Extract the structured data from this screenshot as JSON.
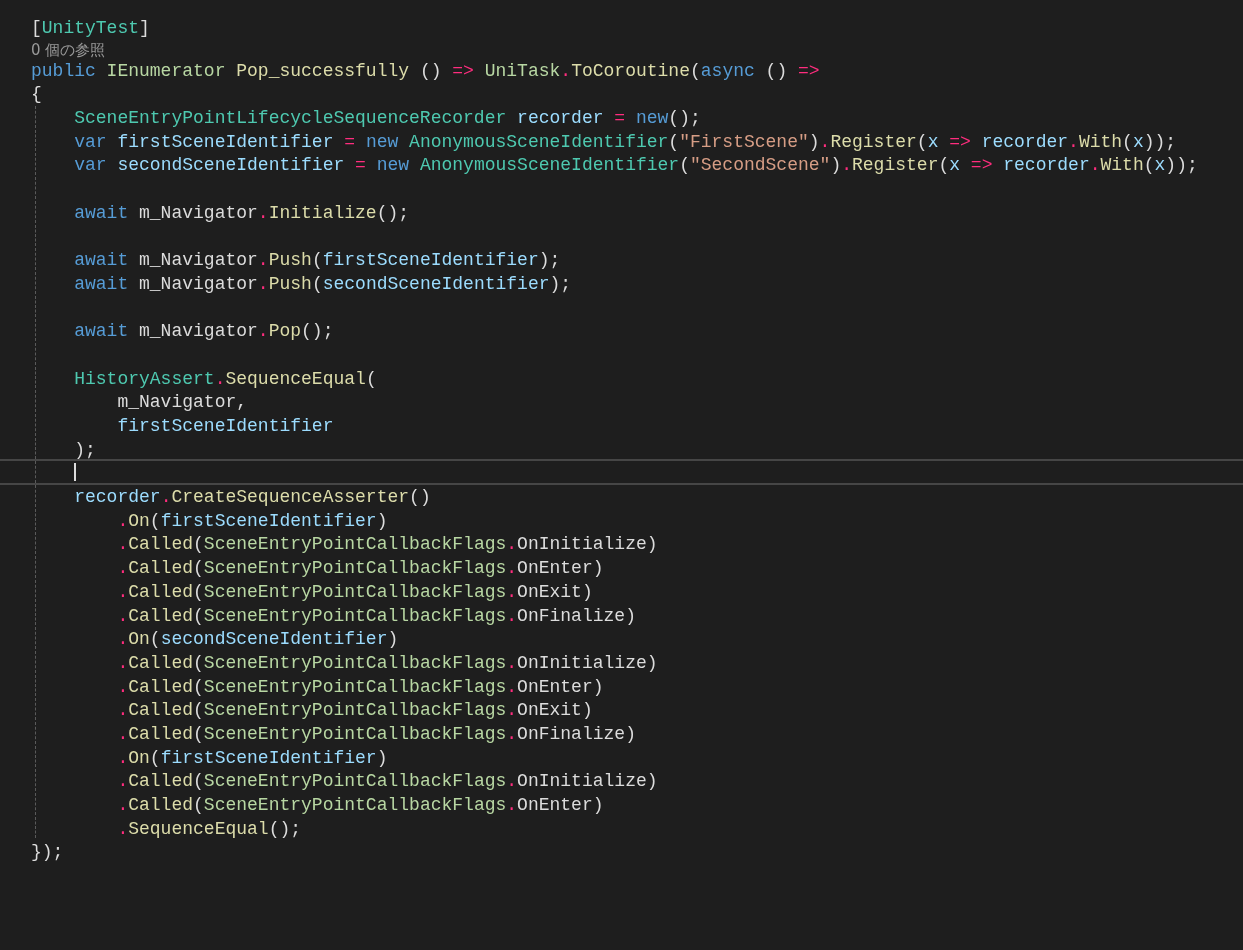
{
  "editor": {
    "lines": [
      {
        "kind": "code",
        "current": false,
        "tokens": [
          {
            "kind": "punct",
            "text": "["
          },
          {
            "kind": "type",
            "text": "UnityTest"
          },
          {
            "kind": "punct",
            "text": "]"
          }
        ]
      },
      {
        "kind": "codelens",
        "current": false,
        "text": "0 個の参照"
      },
      {
        "kind": "code",
        "current": false,
        "tokens": [
          {
            "kind": "keyword",
            "text": "public"
          },
          {
            "kind": "interface",
            "text": " IEnumerator"
          },
          {
            "kind": "method",
            "text": " Pop_successfully"
          },
          {
            "kind": "punct",
            "text": " () "
          },
          {
            "kind": "operator",
            "text": "=>"
          },
          {
            "kind": "interface",
            "text": " UniTask"
          },
          {
            "kind": "operator",
            "text": "."
          },
          {
            "kind": "method",
            "text": "ToCoroutine"
          },
          {
            "kind": "punct",
            "text": "("
          },
          {
            "kind": "keyword",
            "text": "async"
          },
          {
            "kind": "punct",
            "text": " () "
          },
          {
            "kind": "operator",
            "text": "=>"
          }
        ]
      },
      {
        "kind": "code",
        "current": false,
        "tokens": [
          {
            "kind": "punct",
            "text": "{"
          }
        ]
      },
      {
        "kind": "code",
        "current": false,
        "tokens": [
          {
            "kind": "type",
            "text": "    SceneEntryPointLifecycleSequenceRecorder"
          },
          {
            "kind": "local",
            "text": " recorder"
          },
          {
            "kind": "operator",
            "text": " ="
          },
          {
            "kind": "keyword",
            "text": " new"
          },
          {
            "kind": "punct",
            "text": "();"
          }
        ]
      },
      {
        "kind": "code",
        "current": false,
        "tokens": [
          {
            "kind": "keyword",
            "text": "    var"
          },
          {
            "kind": "local",
            "text": " firstSceneIdentifier"
          },
          {
            "kind": "operator",
            "text": " ="
          },
          {
            "kind": "keyword",
            "text": " new"
          },
          {
            "kind": "type",
            "text": " AnonymousSceneIdentifier"
          },
          {
            "kind": "punct",
            "text": "("
          },
          {
            "kind": "string",
            "text": "\"FirstScene\""
          },
          {
            "kind": "punct",
            "text": ")"
          },
          {
            "kind": "operator",
            "text": "."
          },
          {
            "kind": "method",
            "text": "Register"
          },
          {
            "kind": "punct",
            "text": "("
          },
          {
            "kind": "local",
            "text": "x"
          },
          {
            "kind": "operator",
            "text": " =>"
          },
          {
            "kind": "local",
            "text": " recorder"
          },
          {
            "kind": "operator",
            "text": "."
          },
          {
            "kind": "method",
            "text": "With"
          },
          {
            "kind": "punct",
            "text": "("
          },
          {
            "kind": "local",
            "text": "x"
          },
          {
            "kind": "punct",
            "text": "));"
          }
        ]
      },
      {
        "kind": "code",
        "current": false,
        "tokens": [
          {
            "kind": "keyword",
            "text": "    var"
          },
          {
            "kind": "local",
            "text": " secondSceneIdentifier"
          },
          {
            "kind": "operator",
            "text": " ="
          },
          {
            "kind": "keyword",
            "text": " new"
          },
          {
            "kind": "type",
            "text": " AnonymousSceneIdentifier"
          },
          {
            "kind": "punct",
            "text": "("
          },
          {
            "kind": "string",
            "text": "\"SecondScene\""
          },
          {
            "kind": "punct",
            "text": ")"
          },
          {
            "kind": "operator",
            "text": "."
          },
          {
            "kind": "method",
            "text": "Register"
          },
          {
            "kind": "punct",
            "text": "("
          },
          {
            "kind": "local",
            "text": "x"
          },
          {
            "kind": "operator",
            "text": " =>"
          },
          {
            "kind": "local",
            "text": " recorder"
          },
          {
            "kind": "operator",
            "text": "."
          },
          {
            "kind": "method",
            "text": "With"
          },
          {
            "kind": "punct",
            "text": "("
          },
          {
            "kind": "local",
            "text": "x"
          },
          {
            "kind": "punct",
            "text": "));"
          }
        ]
      },
      {
        "kind": "code",
        "current": false
      },
      {
        "kind": "code",
        "current": false,
        "tokens": [
          {
            "kind": "keyword",
            "text": "    await"
          },
          {
            "kind": "field",
            "text": " m_Navigator"
          },
          {
            "kind": "operator",
            "text": "."
          },
          {
            "kind": "method",
            "text": "Initialize"
          },
          {
            "kind": "punct",
            "text": "();"
          }
        ]
      },
      {
        "kind": "code",
        "current": false
      },
      {
        "kind": "code",
        "current": false,
        "tokens": [
          {
            "kind": "keyword",
            "text": "    await"
          },
          {
            "kind": "field",
            "text": " m_Navigator"
          },
          {
            "kind": "operator",
            "text": "."
          },
          {
            "kind": "method",
            "text": "Push"
          },
          {
            "kind": "punct",
            "text": "("
          },
          {
            "kind": "local",
            "text": "firstSceneIdentifier"
          },
          {
            "kind": "punct",
            "text": ");"
          }
        ]
      },
      {
        "kind": "code",
        "current": false,
        "tokens": [
          {
            "kind": "keyword",
            "text": "    await"
          },
          {
            "kind": "field",
            "text": " m_Navigator"
          },
          {
            "kind": "operator",
            "text": "."
          },
          {
            "kind": "method",
            "text": "Push"
          },
          {
            "kind": "punct",
            "text": "("
          },
          {
            "kind": "local",
            "text": "secondSceneIdentifier"
          },
          {
            "kind": "punct",
            "text": ");"
          }
        ]
      },
      {
        "kind": "code",
        "current": false
      },
      {
        "kind": "code",
        "current": false,
        "tokens": [
          {
            "kind": "keyword",
            "text": "    await"
          },
          {
            "kind": "field",
            "text": " m_Navigator"
          },
          {
            "kind": "operator",
            "text": "."
          },
          {
            "kind": "method",
            "text": "Pop"
          },
          {
            "kind": "punct",
            "text": "();"
          }
        ]
      },
      {
        "kind": "code",
        "current": false
      },
      {
        "kind": "code",
        "current": false,
        "tokens": [
          {
            "kind": "type",
            "text": "    HistoryAssert"
          },
          {
            "kind": "operator",
            "text": "."
          },
          {
            "kind": "method",
            "text": "SequenceEqual"
          },
          {
            "kind": "punct",
            "text": "("
          }
        ]
      },
      {
        "kind": "code",
        "current": false,
        "tokens": [
          {
            "kind": "field",
            "text": "        m_Navigator"
          },
          {
            "kind": "punct",
            "text": ","
          }
        ]
      },
      {
        "kind": "code",
        "current": false,
        "tokens": [
          {
            "kind": "local",
            "text": "        firstSceneIdentifier"
          }
        ]
      },
      {
        "kind": "code",
        "current": false,
        "tokens": [
          {
            "kind": "punct",
            "text": "    );"
          }
        ]
      },
      {
        "kind": "code",
        "current": true
      },
      {
        "kind": "code",
        "current": false,
        "tokens": [
          {
            "kind": "local",
            "text": "    recorder"
          },
          {
            "kind": "operator",
            "text": "."
          },
          {
            "kind": "method",
            "text": "CreateSequenceAsserter"
          },
          {
            "kind": "punct",
            "text": "()"
          }
        ]
      },
      {
        "kind": "code",
        "current": false,
        "tokens": [
          {
            "kind": "operator",
            "text": "        ."
          },
          {
            "kind": "method",
            "text": "On"
          },
          {
            "kind": "punct",
            "text": "("
          },
          {
            "kind": "local",
            "text": "firstSceneIdentifier"
          },
          {
            "kind": "punct",
            "text": ")"
          }
        ]
      },
      {
        "kind": "code",
        "current": false,
        "tokens": [
          {
            "kind": "operator",
            "text": "        ."
          },
          {
            "kind": "method",
            "text": "Called"
          },
          {
            "kind": "punct",
            "text": "("
          },
          {
            "kind": "interface",
            "text": "SceneEntryPointCallbackFlags"
          },
          {
            "kind": "operator",
            "text": "."
          },
          {
            "kind": "field",
            "text": "OnInitialize"
          },
          {
            "kind": "punct",
            "text": ")"
          }
        ]
      },
      {
        "kind": "code",
        "current": false,
        "tokens": [
          {
            "kind": "operator",
            "text": "        ."
          },
          {
            "kind": "method",
            "text": "Called"
          },
          {
            "kind": "punct",
            "text": "("
          },
          {
            "kind": "interface",
            "text": "SceneEntryPointCallbackFlags"
          },
          {
            "kind": "operator",
            "text": "."
          },
          {
            "kind": "field",
            "text": "OnEnter"
          },
          {
            "kind": "punct",
            "text": ")"
          }
        ]
      },
      {
        "kind": "code",
        "current": false,
        "tokens": [
          {
            "kind": "operator",
            "text": "        ."
          },
          {
            "kind": "method",
            "text": "Called"
          },
          {
            "kind": "punct",
            "text": "("
          },
          {
            "kind": "interface",
            "text": "SceneEntryPointCallbackFlags"
          },
          {
            "kind": "operator",
            "text": "."
          },
          {
            "kind": "field",
            "text": "OnExit"
          },
          {
            "kind": "punct",
            "text": ")"
          }
        ]
      },
      {
        "kind": "code",
        "current": false,
        "tokens": [
          {
            "kind": "operator",
            "text": "        ."
          },
          {
            "kind": "method",
            "text": "Called"
          },
          {
            "kind": "punct",
            "text": "("
          },
          {
            "kind": "interface",
            "text": "SceneEntryPointCallbackFlags"
          },
          {
            "kind": "operator",
            "text": "."
          },
          {
            "kind": "field",
            "text": "OnFinalize"
          },
          {
            "kind": "punct",
            "text": ")"
          }
        ]
      },
      {
        "kind": "code",
        "current": false,
        "tokens": [
          {
            "kind": "operator",
            "text": "        ."
          },
          {
            "kind": "method",
            "text": "On"
          },
          {
            "kind": "punct",
            "text": "("
          },
          {
            "kind": "local",
            "text": "secondSceneIdentifier"
          },
          {
            "kind": "punct",
            "text": ")"
          }
        ]
      },
      {
        "kind": "code",
        "current": false,
        "tokens": [
          {
            "kind": "operator",
            "text": "        ."
          },
          {
            "kind": "method",
            "text": "Called"
          },
          {
            "kind": "punct",
            "text": "("
          },
          {
            "kind": "interface",
            "text": "SceneEntryPointCallbackFlags"
          },
          {
            "kind": "operator",
            "text": "."
          },
          {
            "kind": "field",
            "text": "OnInitialize"
          },
          {
            "kind": "punct",
            "text": ")"
          }
        ]
      },
      {
        "kind": "code",
        "current": false,
        "tokens": [
          {
            "kind": "operator",
            "text": "        ."
          },
          {
            "kind": "method",
            "text": "Called"
          },
          {
            "kind": "punct",
            "text": "("
          },
          {
            "kind": "interface",
            "text": "SceneEntryPointCallbackFlags"
          },
          {
            "kind": "operator",
            "text": "."
          },
          {
            "kind": "field",
            "text": "OnEnter"
          },
          {
            "kind": "punct",
            "text": ")"
          }
        ]
      },
      {
        "kind": "code",
        "current": false,
        "tokens": [
          {
            "kind": "operator",
            "text": "        ."
          },
          {
            "kind": "method",
            "text": "Called"
          },
          {
            "kind": "punct",
            "text": "("
          },
          {
            "kind": "interface",
            "text": "SceneEntryPointCallbackFlags"
          },
          {
            "kind": "operator",
            "text": "."
          },
          {
            "kind": "field",
            "text": "OnExit"
          },
          {
            "kind": "punct",
            "text": ")"
          }
        ]
      },
      {
        "kind": "code",
        "current": false,
        "tokens": [
          {
            "kind": "operator",
            "text": "        ."
          },
          {
            "kind": "method",
            "text": "Called"
          },
          {
            "kind": "punct",
            "text": "("
          },
          {
            "kind": "interface",
            "text": "SceneEntryPointCallbackFlags"
          },
          {
            "kind": "operator",
            "text": "."
          },
          {
            "kind": "field",
            "text": "OnFinalize"
          },
          {
            "kind": "punct",
            "text": ")"
          }
        ]
      },
      {
        "kind": "code",
        "current": false,
        "tokens": [
          {
            "kind": "operator",
            "text": "        ."
          },
          {
            "kind": "method",
            "text": "On"
          },
          {
            "kind": "punct",
            "text": "("
          },
          {
            "kind": "local",
            "text": "firstSceneIdentifier"
          },
          {
            "kind": "punct",
            "text": ")"
          }
        ]
      },
      {
        "kind": "code",
        "current": false,
        "tokens": [
          {
            "kind": "operator",
            "text": "        ."
          },
          {
            "kind": "method",
            "text": "Called"
          },
          {
            "kind": "punct",
            "text": "("
          },
          {
            "kind": "interface",
            "text": "SceneEntryPointCallbackFlags"
          },
          {
            "kind": "operator",
            "text": "."
          },
          {
            "kind": "field",
            "text": "OnInitialize"
          },
          {
            "kind": "punct",
            "text": ")"
          }
        ]
      },
      {
        "kind": "code",
        "current": false,
        "tokens": [
          {
            "kind": "operator",
            "text": "        ."
          },
          {
            "kind": "method",
            "text": "Called"
          },
          {
            "kind": "punct",
            "text": "("
          },
          {
            "kind": "interface",
            "text": "SceneEntryPointCallbackFlags"
          },
          {
            "kind": "operator",
            "text": "."
          },
          {
            "kind": "field",
            "text": "OnEnter"
          },
          {
            "kind": "punct",
            "text": ")"
          }
        ]
      },
      {
        "kind": "code",
        "current": false,
        "tokens": [
          {
            "kind": "operator",
            "text": "        ."
          },
          {
            "kind": "method",
            "text": "SequenceEqual"
          },
          {
            "kind": "punct",
            "text": "();"
          }
        ]
      },
      {
        "kind": "code",
        "current": false,
        "tokens": [
          {
            "kind": "punct",
            "text": "});"
          }
        ]
      }
    ]
  }
}
